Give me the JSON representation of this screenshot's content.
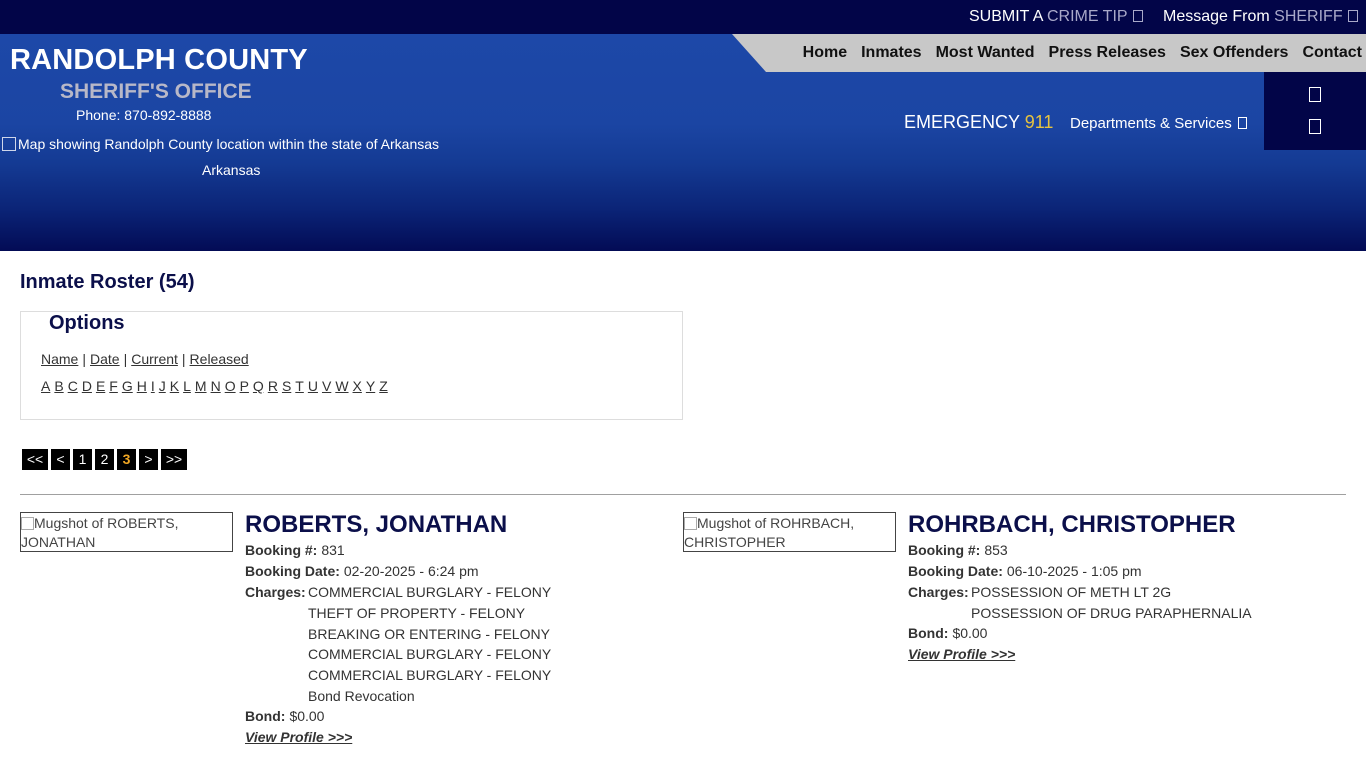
{
  "topbar": {
    "tip_prefix": "SUBMIT A ",
    "tip_highlight": "CRIME TIP",
    "message_prefix": "Message From ",
    "message_highlight": "SHERIFF"
  },
  "brand": {
    "title": "RANDOLPH COUNTY",
    "subtitle": "SHERIFF'S OFFICE",
    "phone": "Phone: 870-892-8888",
    "map_alt": "Map showing Randolph County location within the state of Arkansas",
    "map_caption": "Arkansas"
  },
  "nav": [
    "Home",
    "Inmates",
    "Most Wanted",
    "Press Releases",
    "Sex Offenders",
    "Contact"
  ],
  "emergency": {
    "label": "EMERGENCY ",
    "number": "911"
  },
  "departments": "Departments & Services",
  "roster": {
    "title": "Inmate Roster (54)",
    "options_legend": "Options",
    "sort_links": [
      "Name",
      "Date",
      "Current",
      "Released"
    ],
    "letters": [
      "A",
      "B",
      "C",
      "D",
      "E",
      "F",
      "G",
      "H",
      "I",
      "J",
      "K",
      "L",
      "M",
      "N",
      "O",
      "P",
      "Q",
      "R",
      "S",
      "T",
      "U",
      "V",
      "W",
      "X",
      "Y",
      "Z"
    ],
    "pager": [
      "<<",
      "<",
      "1",
      "2",
      "3",
      ">",
      ">>"
    ],
    "current_page": "3"
  },
  "labels": {
    "booking_no": "Booking #:",
    "booking_date": "Booking Date:",
    "charges": "Charges:",
    "bond": "Bond:",
    "view_profile": "View Profile >>>"
  },
  "inmates": [
    {
      "mug_alt": "Mugshot of ROBERTS, JONATHAN",
      "name": "ROBERTS, JONATHAN",
      "booking_no": "831",
      "booking_date": "02-20-2025 - 6:24 pm",
      "charges": [
        "COMMERCIAL BURGLARY - FELONY",
        "THEFT OF PROPERTY - FELONY",
        "BREAKING OR ENTERING - FELONY",
        "COMMERCIAL BURGLARY - FELONY",
        "COMMERCIAL BURGLARY - FELONY",
        "Bond Revocation"
      ],
      "bond": "$0.00"
    },
    {
      "mug_alt": "Mugshot of ROHRBACH, CHRISTOPHER",
      "name": "ROHRBACH, CHRISTOPHER",
      "booking_no": "853",
      "booking_date": "06-10-2025 - 1:05 pm",
      "charges": [
        "POSSESSION OF METH LT 2G",
        "POSSESSION OF DRUG PARAPHERNALIA"
      ],
      "bond": "$0.00"
    }
  ]
}
